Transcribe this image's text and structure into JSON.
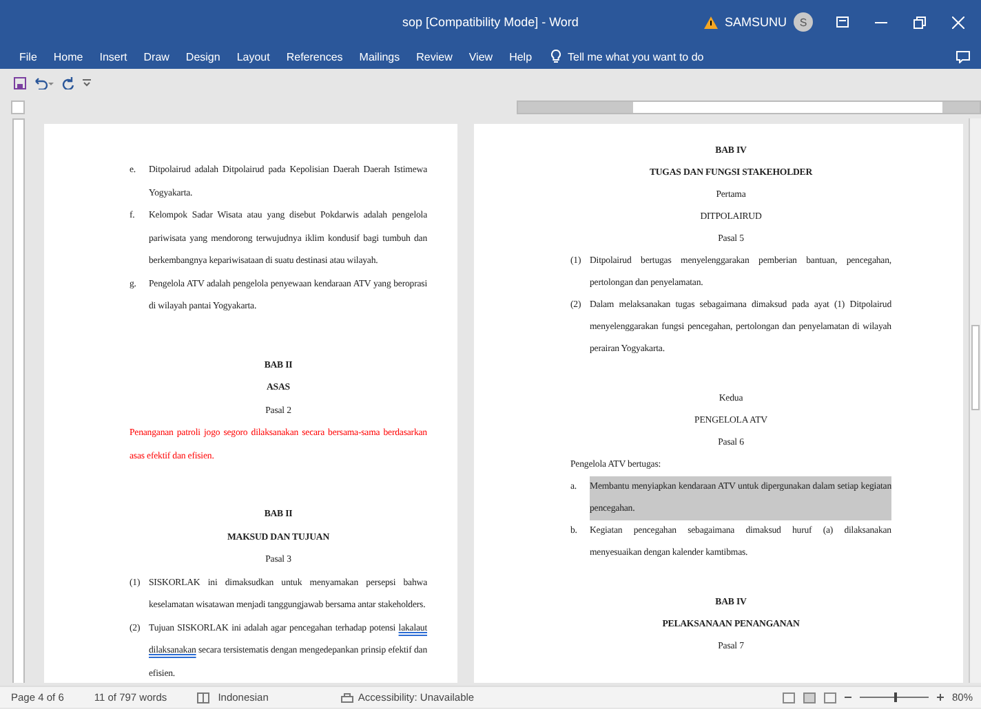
{
  "window": {
    "title": "sop [Compatibility Mode]  -  Word",
    "user": "SAMSUNU",
    "avatar_initial": "S"
  },
  "ribbon_tabs": [
    {
      "label": "File",
      "selected": false
    },
    {
      "label": "Home",
      "selected": false
    },
    {
      "label": "Insert",
      "selected": false
    },
    {
      "label": "Draw",
      "selected": false
    },
    {
      "label": "Design",
      "selected": false
    },
    {
      "label": "Layout",
      "selected": false
    },
    {
      "label": "References",
      "selected": false
    },
    {
      "label": "Mailings",
      "selected": false
    },
    {
      "label": "Review",
      "selected": false
    },
    {
      "label": "View",
      "selected": false
    },
    {
      "label": "Help",
      "selected": false
    }
  ],
  "tell_me": {
    "placeholder": "Tell me what you want to do"
  },
  "pages": [
    {
      "blocks": [
        {
          "kind": "item",
          "marker": "e.",
          "text": "Ditpolairud adalah Ditpolairud pada Kepolisian Daerah Daerah Istimewa Yogyakarta."
        },
        {
          "kind": "item",
          "marker": "f.",
          "text": "Kelompok Sadar Wisata atau yang disebut Pokdarwis adalah pengelola pariwisata yang  mendorong terwujudnya iklim kondusif bagi tumbuh dan berkembangnya kepariwisataan di suatu destinasi atau wilayah."
        },
        {
          "kind": "item",
          "marker": "g.",
          "text": "Pengelola ATV adalah pengelola penyewaan kendaraan ATV yang beroprasi di wilayah pantai Yogyakarta."
        },
        {
          "kind": "center",
          "text": "BAB II",
          "bold": true,
          "space_before": true
        },
        {
          "kind": "center",
          "text": "ASAS",
          "bold": true
        },
        {
          "kind": "center",
          "text": "Pasal 2"
        },
        {
          "kind": "para",
          "text": "Penanganan patroli jogo segoro dilaksanakan secara bersama-sama berdasarkan asas efektif dan efisien.",
          "color": "#ff0000"
        },
        {
          "kind": "center",
          "text": "BAB II",
          "bold": true,
          "space_before": true
        },
        {
          "kind": "center",
          "text": "MAKSUD DAN TUJUAN",
          "bold": true
        },
        {
          "kind": "center",
          "text": "Pasal 3"
        },
        {
          "kind": "item",
          "marker": "(1)",
          "text": "SISKORLAK ini dimaksudkan untuk menyamakan persepsi bahwa keselamatan wisatawan menjadi tanggungjawab bersama antar stakeholders."
        },
        {
          "kind": "item",
          "marker": "(2)",
          "text": "Tujuan SISKORLAK ini adalah agar pencegahan terhadap potensi *lakalaut dilaksanakan* secara tersistematis dengan mengedepankan prinsip efektif dan efisien."
        }
      ]
    },
    {
      "blocks": [
        {
          "kind": "center",
          "text": "BAB IV",
          "bold": true
        },
        {
          "kind": "center",
          "text": "TUGAS DAN FUNGSI STAKEHOLDER",
          "bold": true
        },
        {
          "kind": "center",
          "text": "Pertama"
        },
        {
          "kind": "center",
          "text": "DITPOLAIRUD"
        },
        {
          "kind": "center",
          "text": "Pasal 5"
        },
        {
          "kind": "item",
          "marker": "(1)",
          "text": "Ditpolairud bertugas menyelenggarakan pemberian bantuan, pencegahan, pertolongan dan penyelamatan."
        },
        {
          "kind": "item",
          "marker": "(2)",
          "text": "Dalam melaksanakan tugas sebagaimana dimaksud pada ayat (1) Ditpolairud menyelenggarakan fungsi pencegahan, pertolongan dan penyelamatan di wilayah perairan Yogyakarta."
        },
        {
          "kind": "center",
          "text": "Kedua",
          "space_before": true
        },
        {
          "kind": "center",
          "text": "PENGELOLA ATV"
        },
        {
          "kind": "center",
          "text": "Pasal 6"
        },
        {
          "kind": "para",
          "text": "Pengelola ATV bertugas:"
        },
        {
          "kind": "item",
          "marker": "a.",
          "text": "Membantu menyiapkan kendaraan ATV untuk dipergunakan dalam setiap kegiatan pencegahan.",
          "highlighted": true
        },
        {
          "kind": "item",
          "marker": "b.",
          "text": "Kegiatan pencegahan sebagaimana dimaksud huruf (a) dilaksanakan menyesuaikan dengan kalender kamtibmas."
        },
        {
          "kind": "center",
          "text": "BAB IV",
          "bold": true,
          "space_before": true
        },
        {
          "kind": "center",
          "text": "PELAKSANAAN PENANGANAN",
          "bold": true
        },
        {
          "kind": "center",
          "text": "Pasal 7"
        }
      ]
    }
  ],
  "status_bar": {
    "page": "Page 4 of 6",
    "words": "11 of 797 words",
    "language": "Indonesian",
    "accessibility": "Accessibility: Unavailable",
    "zoom": "80%",
    "zoom_slider": {
      "level": 0.5
    }
  }
}
